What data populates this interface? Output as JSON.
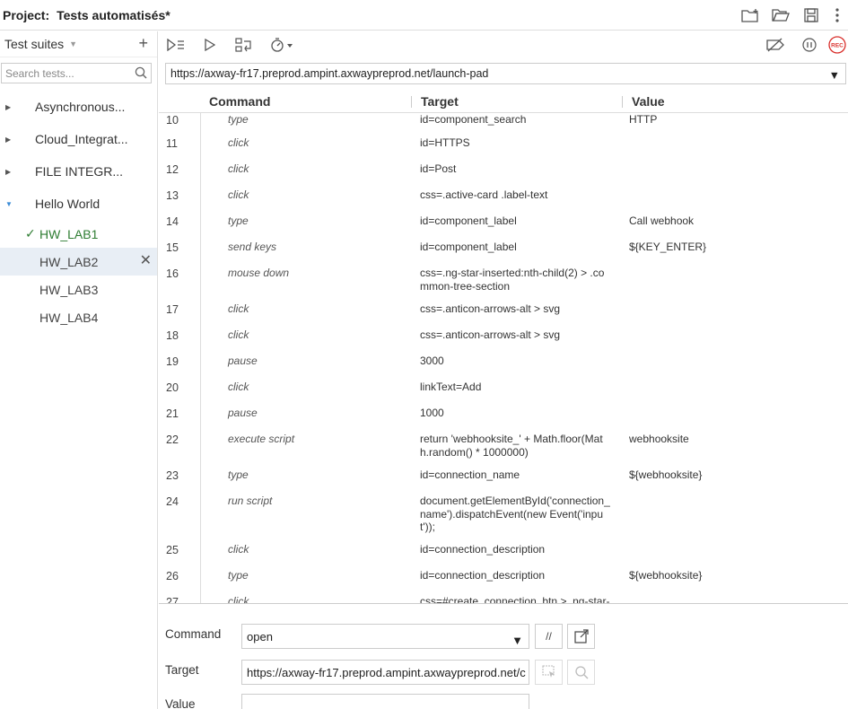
{
  "header": {
    "project_label": "Project:",
    "project_name": "Tests automatisés*"
  },
  "sidebar": {
    "suites_label": "Test suites",
    "search_placeholder": "Search tests...",
    "suites": [
      {
        "label": "Asynchronous...",
        "expanded": false
      },
      {
        "label": "Cloud_Integrat...",
        "expanded": false
      },
      {
        "label": "FILE INTEGR...",
        "expanded": false
      },
      {
        "label": "Hello World",
        "expanded": true
      }
    ],
    "tests": [
      {
        "label": "HW_LAB1",
        "status": "passed"
      },
      {
        "label": "HW_LAB2",
        "status": "selected"
      },
      {
        "label": "HW_LAB3",
        "status": ""
      },
      {
        "label": "HW_LAB4",
        "status": ""
      }
    ]
  },
  "url_bar": {
    "value": "https://axway-fr17.preprod.ampint.axwaypreprod.net/launch-pad"
  },
  "table": {
    "columns": [
      "Command",
      "Target",
      "Value"
    ],
    "rows": [
      {
        "num": "10",
        "cmd": "type",
        "target": "id=component_search",
        "value": "HTTP"
      },
      {
        "num": "11",
        "cmd": "click",
        "target": "id=HTTPS",
        "value": ""
      },
      {
        "num": "12",
        "cmd": "click",
        "target": "id=Post",
        "value": ""
      },
      {
        "num": "13",
        "cmd": "click",
        "target": "css=.active-card .label-text",
        "value": ""
      },
      {
        "num": "14",
        "cmd": "type",
        "target": "id=component_label",
        "value": "Call webhook"
      },
      {
        "num": "15",
        "cmd": "send keys",
        "target": "id=component_label",
        "value": "${KEY_ENTER}"
      },
      {
        "num": "16",
        "cmd": "mouse down",
        "target": "css=.ng-star-inserted:nth-child(2) > .common-tree-section",
        "value": ""
      },
      {
        "num": "17",
        "cmd": "click",
        "target": "css=.anticon-arrows-alt > svg",
        "value": ""
      },
      {
        "num": "18",
        "cmd": "click",
        "target": "css=.anticon-arrows-alt > svg",
        "value": ""
      },
      {
        "num": "19",
        "cmd": "pause",
        "target": "3000",
        "value": ""
      },
      {
        "num": "20",
        "cmd": "click",
        "target": "linkText=Add",
        "value": ""
      },
      {
        "num": "21",
        "cmd": "pause",
        "target": "1000",
        "value": ""
      },
      {
        "num": "22",
        "cmd": "execute script",
        "target": "return 'webhooksite_' + Math.floor(Math.random() * 1000000)",
        "value": "webhooksite"
      },
      {
        "num": "23",
        "cmd": "type",
        "target": "id=connection_name",
        "value": "${webhooksite}"
      },
      {
        "num": "24",
        "cmd": "run script",
        "target": "document.getElementById('connection_name').dispatchEvent(new Event('input'));",
        "value": ""
      },
      {
        "num": "25",
        "cmd": "click",
        "target": "id=connection_description",
        "value": ""
      },
      {
        "num": "26",
        "cmd": "type",
        "target": "id=connection_description",
        "value": "${webhooksite}"
      },
      {
        "num": "27",
        "cmd": "click",
        "target": "css=#create_connection_btn > .ng-star-inserted",
        "value": ""
      }
    ]
  },
  "editor": {
    "command_label": "Command",
    "command_value": "open",
    "target_label": "Target",
    "target_value": "https://axway-fr17.preprod.ampint.axwaypreprod.net/c",
    "value_label": "Value",
    "value_value": "",
    "comment_btn": "//"
  },
  "colors": {
    "accent": "#3a8bd6",
    "passed": "#2e7d32",
    "rec": "#d9302c"
  }
}
